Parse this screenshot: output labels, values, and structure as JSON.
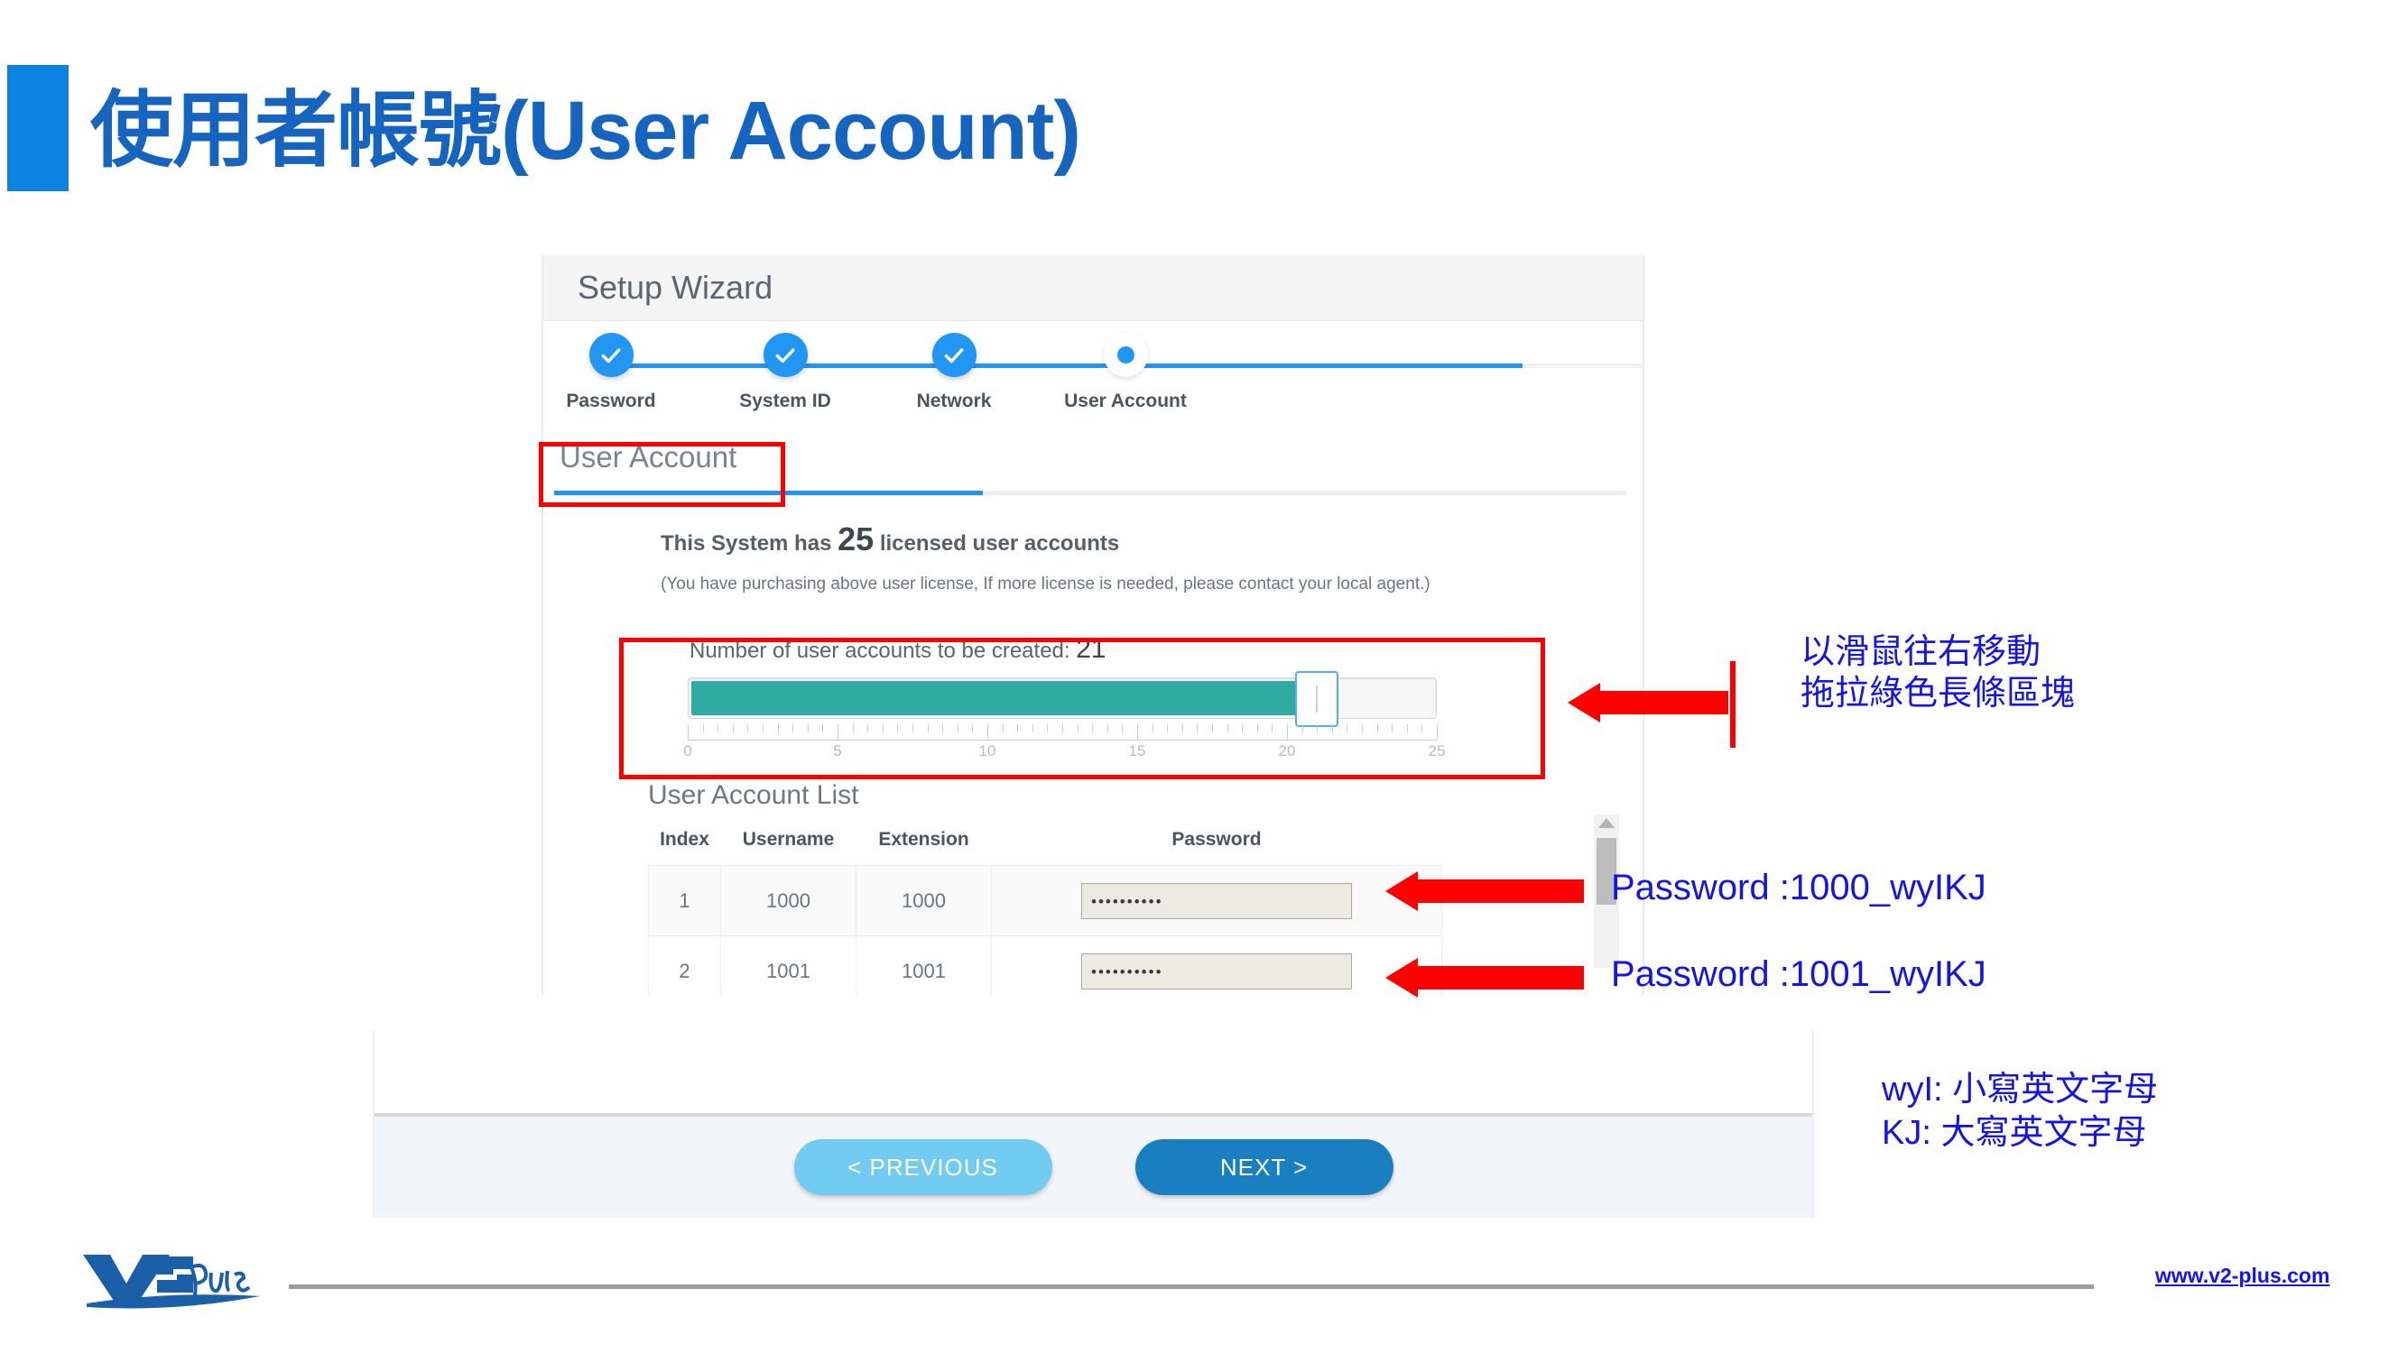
{
  "slide": {
    "title": "使用者帳號(User Account)",
    "accent_color": "#0c83e2",
    "title_color": "#1565c0"
  },
  "app": {
    "header_title": "Setup Wizard",
    "steps": [
      {
        "label": "Password",
        "state": "done"
      },
      {
        "label": "System ID",
        "state": "done"
      },
      {
        "label": "Network",
        "state": "done"
      },
      {
        "label": "User Account",
        "state": "current"
      }
    ],
    "tab_title": "User Account",
    "license": {
      "prefix": "This System has",
      "count": "25",
      "suffix": "licensed user accounts",
      "note": "(You have purchasing above user license, If more license is needed, please contact your local agent.)"
    },
    "slider": {
      "caption": "Number of user accounts to be created:",
      "value": "21",
      "min": "0",
      "max": "25",
      "tick_labels": [
        "0",
        "5",
        "10",
        "15",
        "20",
        "25"
      ],
      "fill_color": "#2faba4"
    },
    "list": {
      "title": "User Account List",
      "columns": [
        "Index",
        "Username",
        "Extension",
        "Password"
      ],
      "rows": [
        {
          "index": "1",
          "username": "1000",
          "extension": "1000",
          "password": "••••••••••"
        },
        {
          "index": "2",
          "username": "1001",
          "extension": "1001",
          "password": "••••••••••"
        }
      ]
    },
    "footer": {
      "previous_label": "< PREVIOUS",
      "next_label": "NEXT >"
    }
  },
  "annotations": {
    "slider_hint_line1": "以滑鼠往右移動",
    "slider_hint_line2": "拖拉綠色長條區塊",
    "password_row1": "Password :1000_wyIKJ",
    "password_row2": "Password :1001_wyIKJ",
    "legend_line1": "wyI: 小寫英文字母",
    "legend_line2": "KJ: 大寫英文字母",
    "color": "#1414e6",
    "box_color": "#ff0000"
  },
  "brand": {
    "name": "v2plus",
    "url": "www.v2-plus.com"
  }
}
